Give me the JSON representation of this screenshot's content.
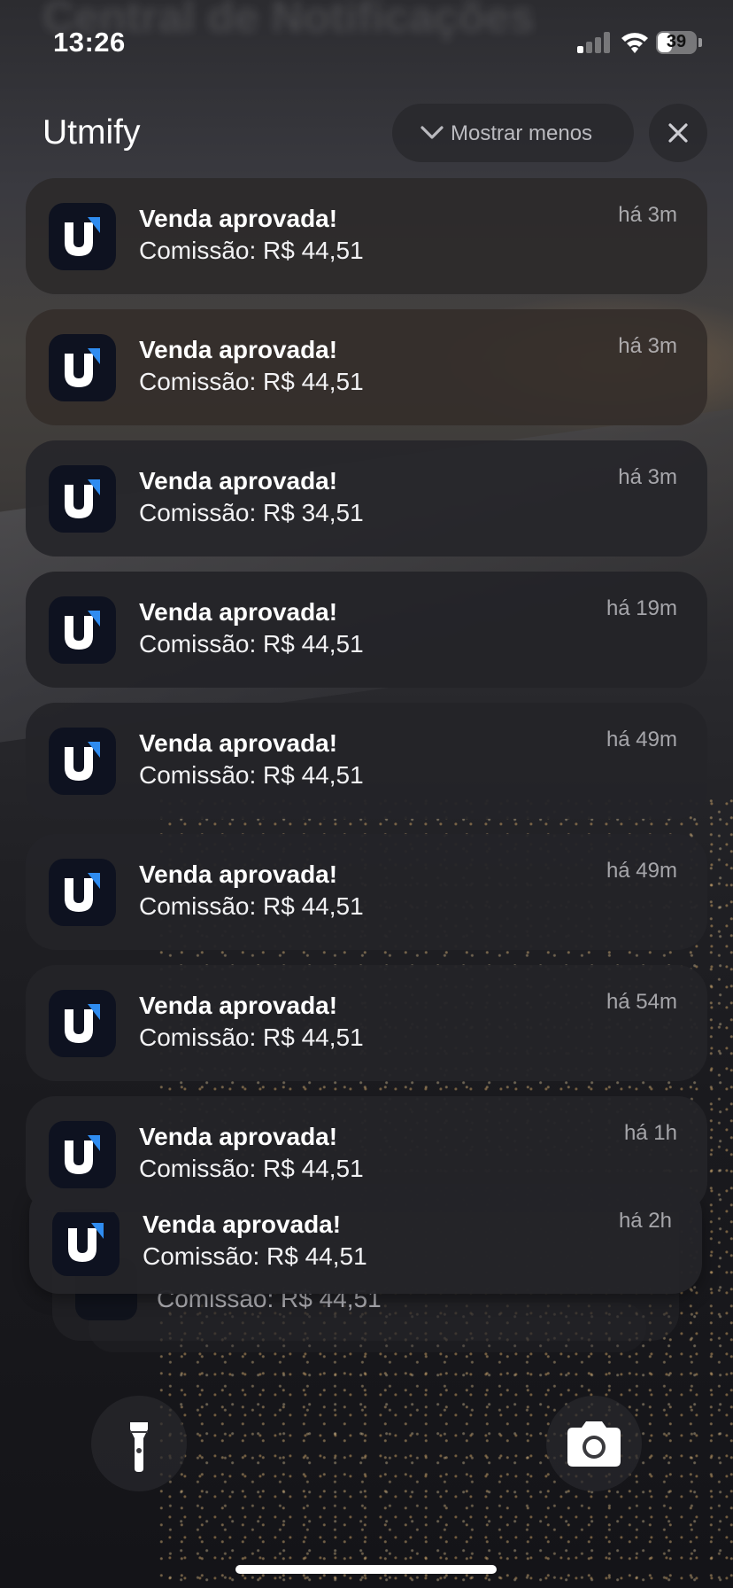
{
  "status_bar": {
    "time": "13:26",
    "battery_level": "39",
    "battery_fraction": 0.39,
    "signal_bars_active": 1,
    "signal_bars_total": 4
  },
  "ghost_header": "Central de Notificações",
  "group": {
    "title": "Utmify",
    "show_less_label": "Mostrar menos",
    "show_less_icon": "chevron-down-icon",
    "close_icon": "close-icon",
    "app_icon": "utmify-logo-icon"
  },
  "notifications": [
    {
      "title": "Venda aprovada!",
      "body": "Comissão: R$ 44,51",
      "time": "há 3m"
    },
    {
      "title": "Venda aprovada!",
      "body": "Comissão: R$ 44,51",
      "time": "há 3m"
    },
    {
      "title": "Venda aprovada!",
      "body": "Comissão: R$ 34,51",
      "time": "há 3m"
    },
    {
      "title": "Venda aprovada!",
      "body": "Comissão: R$ 44,51",
      "time": "há 19m"
    },
    {
      "title": "Venda aprovada!",
      "body": "Comissão: R$ 44,51",
      "time": "há 49m"
    },
    {
      "title": "Venda aprovada!",
      "body": "Comissão: R$ 44,51",
      "time": "há 49m"
    },
    {
      "title": "Venda aprovada!",
      "body": "Comissão: R$ 44,51",
      "time": "há 54m"
    },
    {
      "title": "Venda aprovada!",
      "body": "Comissão: R$ 44,51",
      "time": "há 1h"
    },
    {
      "title": "Venda aprovada!",
      "body": "Comissão: R$ 44,51",
      "time": "há 2h"
    }
  ],
  "stacked_hidden": {
    "body": "Comissão: R$ 44,51"
  },
  "quick_actions": {
    "left_icon": "flashlight-icon",
    "right_icon": "camera-icon"
  },
  "colors": {
    "card_bg": "#26262a",
    "accent_blue": "#2f8cf0",
    "icon_bg": "#0e1220"
  }
}
